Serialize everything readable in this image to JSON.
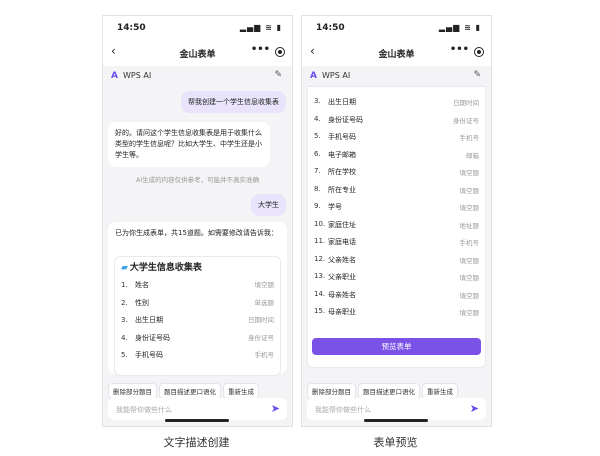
{
  "left": {
    "status": {
      "time": "14:50",
      "icons": "▂▄▆ ≋ ▮"
    },
    "nav": {
      "back": "‹",
      "title": "金山表单",
      "more": "•••"
    },
    "ai": {
      "logo": "A",
      "name": "WPS AI",
      "edit": "✎"
    },
    "user_msg_1": "帮我创建一个学生信息收集表",
    "ai_msg_1": "好的。请问这个学生信息收集表是用于收集什么类型的学生信息呢？比如大学生、中学生还是小学生等。",
    "disclaimer": "AI生成的内容仅供参考，可能并不真实准确",
    "user_msg_2": "大学生",
    "ai_msg_2": "已为你生成表单，共15道题。如需要修改请告诉我：",
    "form_title": "大学生信息收集表",
    "fields": [
      {
        "num": "1.",
        "label": "姓名",
        "type": "填空题"
      },
      {
        "num": "2.",
        "label": "性别",
        "type": "单选题"
      },
      {
        "num": "3.",
        "label": "出生日期",
        "type": "日期时间"
      },
      {
        "num": "4.",
        "label": "身份证号码",
        "type": "身份证号"
      },
      {
        "num": "5.",
        "label": "手机号码",
        "type": "手机号"
      }
    ],
    "actions": [
      "删除部分题目",
      "题目描述更口语化",
      "重新生成"
    ],
    "input_placeholder": "我能帮你做些什么",
    "send_icon": "➤"
  },
  "right": {
    "status": {
      "time": "14:50",
      "icons": "▂▄▆ ≋ ▮"
    },
    "nav": {
      "back": "‹",
      "title": "金山表单",
      "more": "•••"
    },
    "ai": {
      "logo": "A",
      "name": "WPS AI",
      "edit": "✎"
    },
    "fields": [
      {
        "num": "3.",
        "label": "出生日期",
        "type": "日期时间"
      },
      {
        "num": "4.",
        "label": "身份证号码",
        "type": "身份证号"
      },
      {
        "num": "5.",
        "label": "手机号码",
        "type": "手机号"
      },
      {
        "num": "6.",
        "label": "电子邮箱",
        "type": "邮箱"
      },
      {
        "num": "7.",
        "label": "所在学校",
        "type": "填空题"
      },
      {
        "num": "8.",
        "label": "所在专业",
        "type": "填空题"
      },
      {
        "num": "9.",
        "label": "学号",
        "type": "填空题"
      },
      {
        "num": "10.",
        "label": "家庭住址",
        "type": "地址题"
      },
      {
        "num": "11.",
        "label": "家庭电话",
        "type": "手机号"
      },
      {
        "num": "12.",
        "label": "父亲姓名",
        "type": "填空题"
      },
      {
        "num": "13.",
        "label": "父亲职业",
        "type": "填空题"
      },
      {
        "num": "14.",
        "label": "母亲姓名",
        "type": "填空题"
      },
      {
        "num": "15.",
        "label": "母亲职业",
        "type": "填空题"
      }
    ],
    "preview_button": "预览表单",
    "actions": [
      "删除部分题目",
      "题目描述更口语化",
      "重新生成"
    ],
    "input_placeholder": "我能帮你做些什么",
    "send_icon": "➤"
  },
  "captions": {
    "left": "文字描述创建",
    "right": "表单预览"
  },
  "colors": {
    "accent": "#7b52e8",
    "user_bubble": "#e9e4fb"
  }
}
